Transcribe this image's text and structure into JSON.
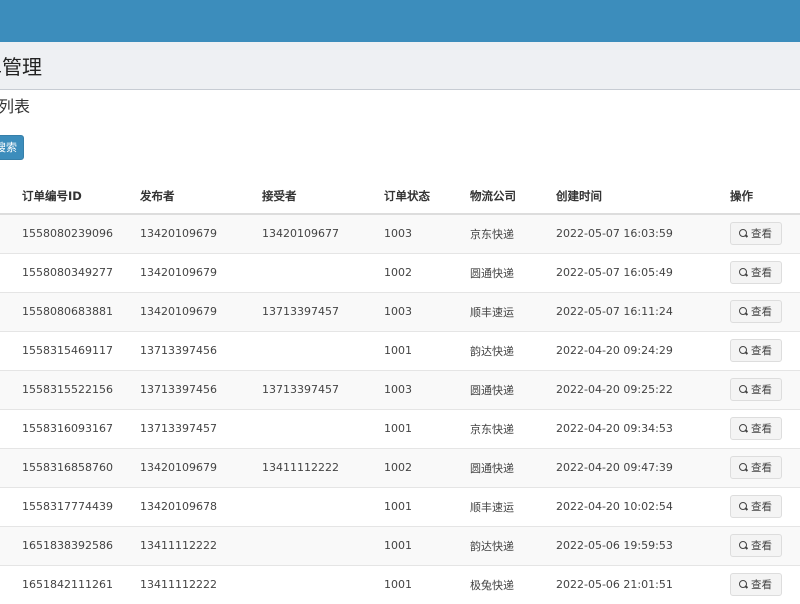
{
  "header": {
    "page_title": "单管理",
    "section_title": "单列表",
    "search_button_label": "搜索"
  },
  "table": {
    "columns": [
      "订单编号ID",
      "发布者",
      "接受者",
      "订单状态",
      "物流公司",
      "创建时间",
      "操作"
    ],
    "view_label": "查看",
    "rows": [
      {
        "id": "1558080239096",
        "publisher": "13420109679",
        "receiver": "13420109677",
        "status": "1003",
        "company": "京东快递",
        "created": "2022-05-07 16:03:59"
      },
      {
        "id": "1558080349277",
        "publisher": "13420109679",
        "receiver": "",
        "status": "1002",
        "company": "圆通快递",
        "created": "2022-05-07 16:05:49"
      },
      {
        "id": "1558080683881",
        "publisher": "13420109679",
        "receiver": "13713397457",
        "status": "1003",
        "company": "顺丰速运",
        "created": "2022-05-07 16:11:24"
      },
      {
        "id": "1558315469117",
        "publisher": "13713397456",
        "receiver": "",
        "status": "1001",
        "company": "韵达快递",
        "created": "2022-04-20 09:24:29"
      },
      {
        "id": "1558315522156",
        "publisher": "13713397456",
        "receiver": "13713397457",
        "status": "1003",
        "company": "圆通快递",
        "created": "2022-04-20 09:25:22"
      },
      {
        "id": "1558316093167",
        "publisher": "13713397457",
        "receiver": "",
        "status": "1001",
        "company": "京东快递",
        "created": "2022-04-20 09:34:53"
      },
      {
        "id": "1558316858760",
        "publisher": "13420109679",
        "receiver": "13411112222",
        "status": "1002",
        "company": "圆通快递",
        "created": "2022-04-20 09:47:39"
      },
      {
        "id": "1558317774439",
        "publisher": "13420109678",
        "receiver": "",
        "status": "1001",
        "company": "顺丰速运",
        "created": "2022-04-20 10:02:54"
      },
      {
        "id": "1651838392586",
        "publisher": "13411112222",
        "receiver": "",
        "status": "1001",
        "company": "韵达快递",
        "created": "2022-05-06 19:59:53"
      },
      {
        "id": "1651842111261",
        "publisher": "13411112222",
        "receiver": "",
        "status": "1001",
        "company": "极兔快递",
        "created": "2022-05-06 21:01:51"
      }
    ]
  },
  "colors": {
    "topbar": "#3c8dbc",
    "header_bg": "#eef0f3",
    "button_primary": "#3c8dbc"
  }
}
